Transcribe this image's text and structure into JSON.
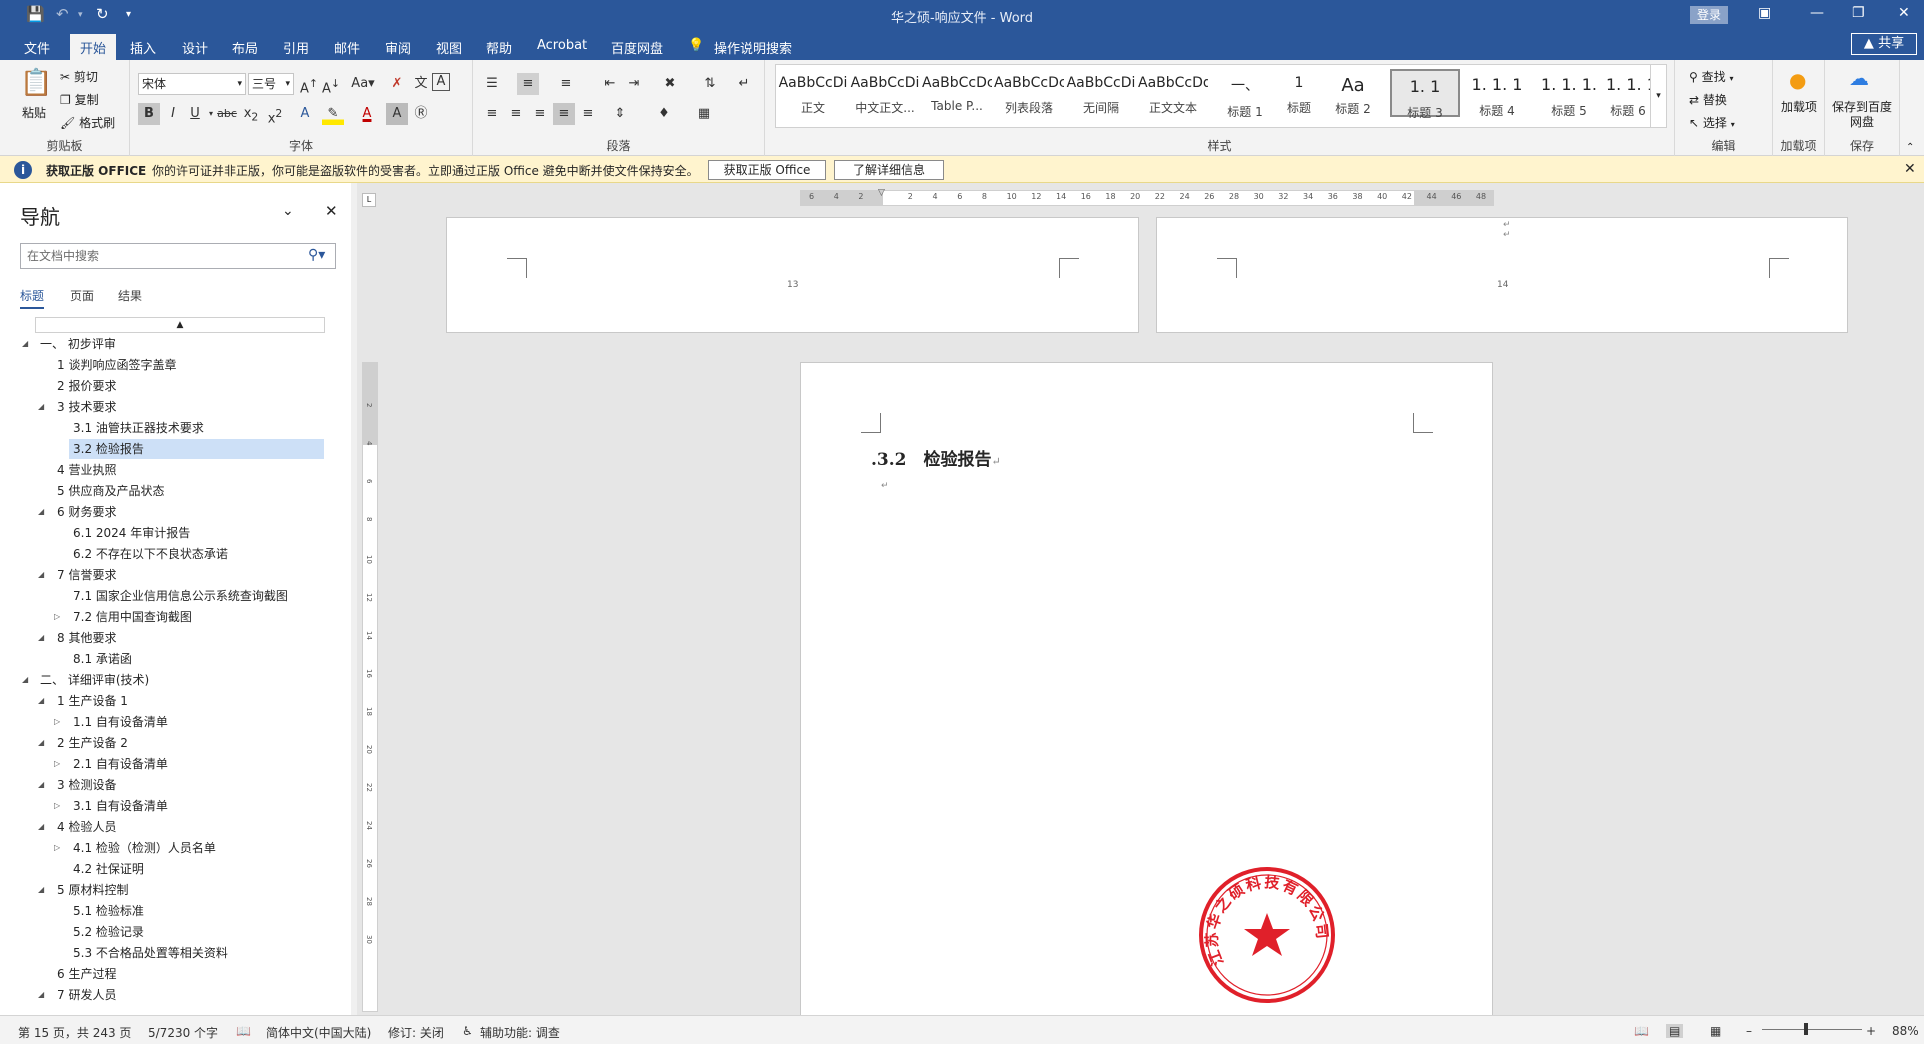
{
  "title_bar": {
    "document_title": "华之硕-响应文件 - Word",
    "login_label": "登录",
    "quick_access": [
      "save-icon",
      "undo-icon",
      "redo-icon",
      "customize-icon"
    ]
  },
  "tabs": [
    "文件",
    "开始",
    "插入",
    "设计",
    "布局",
    "引用",
    "邮件",
    "审阅",
    "视图",
    "帮助",
    "Acrobat",
    "百度网盘"
  ],
  "active_tab": "开始",
  "tell_me": "操作说明搜索",
  "share_label": "共享",
  "ribbon": {
    "clipboard": {
      "paste": "粘贴",
      "cut": "剪切",
      "copy": "复制",
      "format_painter": "格式刷",
      "label": "剪贴板"
    },
    "font": {
      "font_name": "宋体",
      "font_size": "三号",
      "label": "字体"
    },
    "paragraph": {
      "label": "段落"
    },
    "styles": {
      "label": "样式",
      "items": [
        {
          "preview": "AaBbCcDi",
          "name": "正文"
        },
        {
          "preview": "AaBbCcDi",
          "name": "中文正文..."
        },
        {
          "preview": "AaBbCcDc",
          "name": "Table P..."
        },
        {
          "preview": "AaBbCcDc",
          "name": "列表段落"
        },
        {
          "preview": "AaBbCcDi",
          "name": "无间隔"
        },
        {
          "preview": "AaBbCcDdI",
          "name": "正文文本"
        },
        {
          "preview": "一、",
          "name": "标题 1"
        },
        {
          "preview": "1",
          "name": "标题"
        },
        {
          "preview": "Aa",
          "name": "标题 2"
        },
        {
          "preview": "1. 1",
          "name": "标题 3"
        },
        {
          "preview": "1. 1. 1",
          "name": "标题 4"
        },
        {
          "preview": "1. 1. 1.",
          "name": "标题 5"
        },
        {
          "preview": "1. 1. 1.",
          "name": "标题 6"
        }
      ]
    },
    "editing": {
      "find": "查找",
      "replace": "替换",
      "select": "选择",
      "label": "编辑"
    },
    "addins": {
      "name": "加载项",
      "label": "加载项"
    },
    "save_baidu": {
      "name": "保存到百度网盘",
      "label": "保存"
    }
  },
  "info_bar": {
    "title": "获取正版 OFFICE",
    "message": "你的许可证并非正版，你可能是盗版软件的受害者。立即通过正版 Office 避免中断并使文件保持安全。",
    "button1": "获取正版 Office",
    "button2": "了解详细信息"
  },
  "nav": {
    "title": "导航",
    "search_placeholder": "在文档中搜索",
    "tabs": [
      "标题",
      "页面",
      "结果"
    ],
    "tree": [
      {
        "text": "一、 初步评审",
        "level": 0,
        "arrow": "down"
      },
      {
        "text": "1 谈判响应函签字盖章",
        "level": 1,
        "arrow": ""
      },
      {
        "text": "2 报价要求",
        "level": 1,
        "arrow": ""
      },
      {
        "text": "3 技术要求",
        "level": 1,
        "arrow": "down"
      },
      {
        "text": "3.1 油管扶正器技术要求",
        "level": 2,
        "arrow": ""
      },
      {
        "text": "3.2 检验报告",
        "level": 2,
        "arrow": "",
        "selected": true
      },
      {
        "text": "4 营业执照",
        "level": 1,
        "arrow": ""
      },
      {
        "text": "5 供应商及产品状态",
        "level": 1,
        "arrow": ""
      },
      {
        "text": "6 财务要求",
        "level": 1,
        "arrow": "down"
      },
      {
        "text": "6.1 2024 年审计报告",
        "level": 2,
        "arrow": ""
      },
      {
        "text": "6.2 不存在以下不良状态承诺",
        "level": 2,
        "arrow": ""
      },
      {
        "text": "7 信誉要求",
        "level": 1,
        "arrow": "down"
      },
      {
        "text": "7.1 国家企业信用信息公示系统查询截图",
        "level": 2,
        "arrow": ""
      },
      {
        "text": "7.2 信用中国查询截图",
        "level": 2,
        "arrow": "right"
      },
      {
        "text": "8 其他要求",
        "level": 1,
        "arrow": "down"
      },
      {
        "text": "8.1 承诺函",
        "level": 2,
        "arrow": ""
      },
      {
        "text": "二、 详细评审(技术)",
        "level": 0,
        "arrow": "down"
      },
      {
        "text": "1 生产设备 1",
        "level": 1,
        "arrow": "down"
      },
      {
        "text": "1.1 自有设备清单",
        "level": 2,
        "arrow": "right"
      },
      {
        "text": "2 生产设备 2",
        "level": 1,
        "arrow": "down"
      },
      {
        "text": "2.1 自有设备清单",
        "level": 2,
        "arrow": "right"
      },
      {
        "text": "3 检测设备",
        "level": 1,
        "arrow": "down"
      },
      {
        "text": "3.1 自有设备清单",
        "level": 2,
        "arrow": "right"
      },
      {
        "text": "4 检验人员",
        "level": 1,
        "arrow": "down"
      },
      {
        "text": "4.1 检验（检测）人员名单",
        "level": 2,
        "arrow": "right"
      },
      {
        "text": "4.2 社保证明",
        "level": 2,
        "arrow": ""
      },
      {
        "text": "5 原材料控制",
        "level": 1,
        "arrow": "down"
      },
      {
        "text": "5.1 检验标准",
        "level": 2,
        "arrow": ""
      },
      {
        "text": "5.2 检验记录",
        "level": 2,
        "arrow": ""
      },
      {
        "text": "5.3 不合格品处置等相关资料",
        "level": 2,
        "arrow": ""
      },
      {
        "text": "6 生产过程",
        "level": 1,
        "arrow": ""
      },
      {
        "text": "7 研发人员",
        "level": 1,
        "arrow": "down"
      }
    ]
  },
  "ruler_ticks": [
    "6",
    "4",
    "2",
    "",
    "2",
    "4",
    "6",
    "8",
    "10",
    "12",
    "14",
    "16",
    "18",
    "20",
    "22",
    "24",
    "26",
    "28",
    "30",
    "32",
    "34",
    "36",
    "38",
    "40",
    "42",
    "44",
    "46",
    "48"
  ],
  "vruler_ticks": [
    "2",
    "4",
    "6",
    "8",
    "10",
    "12",
    "14",
    "16",
    "18",
    "20",
    "22",
    "24",
    "26",
    "28",
    "30"
  ],
  "document": {
    "page13_number": "13",
    "page14_number": "14",
    "heading": ".3.2　检验报告",
    "seal_text": "江苏华之硕科技有限公司"
  },
  "status": {
    "page": "第 15 页，共 243 页",
    "words": "5/7230 个字",
    "language": "简体中文(中国大陆)",
    "track": "修订: 关闭",
    "accessibility": "辅助功能: 调查",
    "zoom": "88%"
  }
}
